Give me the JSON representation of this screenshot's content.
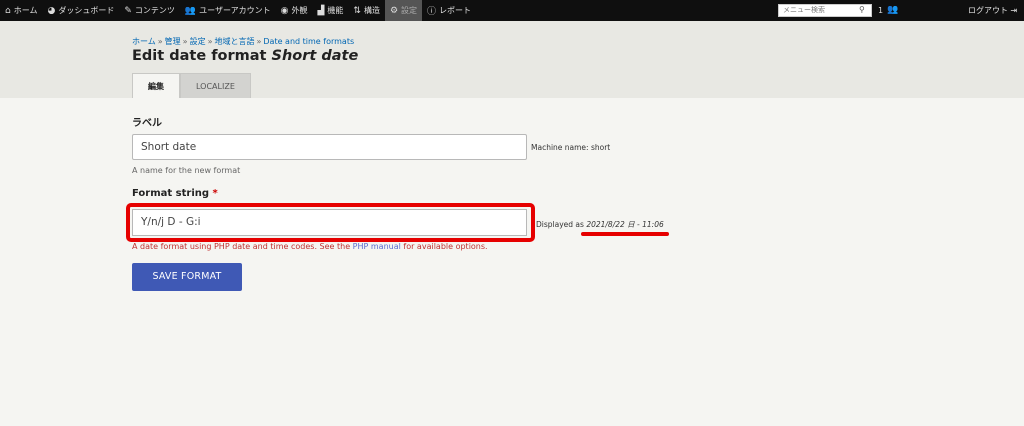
{
  "toolbar": {
    "items": [
      {
        "icon": "home-icon",
        "glyph": "⌂",
        "label": "ホーム"
      },
      {
        "icon": "dashboard-icon",
        "glyph": "◕",
        "label": "ダッシュボード"
      },
      {
        "icon": "pencil-icon",
        "glyph": "✎",
        "label": "コンテンツ"
      },
      {
        "icon": "users-icon",
        "glyph": "👥",
        "label": "ユーザーアカウント"
      },
      {
        "icon": "palette-icon",
        "glyph": "◉",
        "label": "外観"
      },
      {
        "icon": "puzzle-icon",
        "glyph": "▟",
        "label": "機能"
      },
      {
        "icon": "structure-icon",
        "glyph": "⇅",
        "label": "構造"
      },
      {
        "icon": "gear-icon",
        "glyph": "⚙",
        "label": "設定"
      },
      {
        "icon": "info-icon",
        "glyph": "ⓘ",
        "label": "レポート"
      }
    ],
    "search_placeholder": "メニュー検索",
    "user_count": "1",
    "logout_label": "ログアウト"
  },
  "breadcrumb": [
    "ホーム",
    "管理",
    "設定",
    "地域と言語",
    "Date and time formats"
  ],
  "page": {
    "title_prefix": "Edit date format",
    "title_emphasis": "Short date"
  },
  "tabs": [
    {
      "label": "編集",
      "active": true
    },
    {
      "label": "LOCALIZE",
      "active": false
    }
  ],
  "form": {
    "label_heading": "ラベル",
    "label_value": "Short date",
    "machine_name": "Machine name: short",
    "label_description": "A name for the new format",
    "format_heading": "Format string",
    "required_marker": "*",
    "format_value": "Y/n/j D - G:i",
    "displayed_as_prefix": "Displayed as",
    "displayed_as_value": "2021/8/22 日 - 11:06",
    "format_description_pre": "A date format using PHP date and time codes. See the ",
    "format_description_link": "PHP manual",
    "format_description_post": " for available options.",
    "save_label": "SAVE FORMAT"
  },
  "colors": {
    "toolbar_bg": "#0f0f0f",
    "accent_button": "#3f59b5",
    "highlight": "#e60000",
    "link": "#0066b3"
  }
}
